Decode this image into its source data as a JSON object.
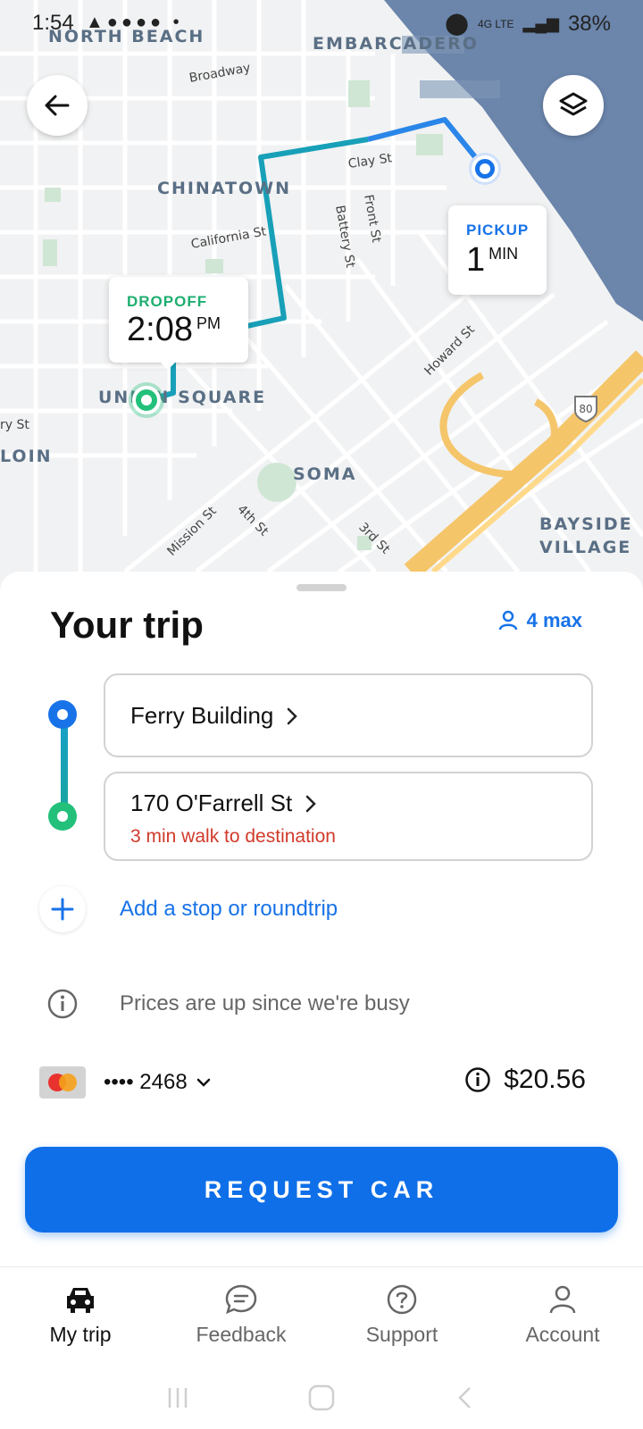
{
  "status_bar": {
    "time": "1:54",
    "battery": "38%",
    "network": "4G LTE"
  },
  "map": {
    "areas": [
      "NORTH BEACH",
      "EMBARCADERO",
      "CHINATOWN",
      "UNION SQUARE",
      "LOIN",
      "SOMA",
      "BAYSIDE",
      "VILLAGE"
    ],
    "streets": [
      "Broadway",
      "Clay St",
      "California St",
      "Front St",
      "Battery St",
      "Howard St",
      "Mission St",
      "4th St",
      "3rd St",
      "ry St"
    ],
    "highway": "80",
    "back_button": "back-arrow-icon",
    "layers_button": "layers-icon",
    "pickup": {
      "caption": "PICKUP",
      "value": "1",
      "unit": "MIN"
    },
    "dropoff": {
      "caption": "DROPOFF",
      "value": "2:08",
      "unit": "PM"
    }
  },
  "trip": {
    "title": "Your trip",
    "max_passengers": "4 max",
    "stops": [
      {
        "name": "Ferry Building"
      },
      {
        "name": "170 O'Farrell St",
        "note": "3 min walk to destination"
      }
    ],
    "add_stop": "Add a stop or roundtrip",
    "price_notice": "Prices are up since we're busy",
    "card_mask": "•••• 2468",
    "price": "$20.56",
    "request_button": "REQUEST CAR"
  },
  "nav": [
    {
      "label": "My trip",
      "icon": "car-icon"
    },
    {
      "label": "Feedback",
      "icon": "chat-icon"
    },
    {
      "label": "Support",
      "icon": "help-icon"
    },
    {
      "label": "Account",
      "icon": "person-icon"
    }
  ],
  "colors": {
    "accent": "#0f6fe9",
    "pickup": "#1873e8",
    "dropoff": "#22c07a",
    "route": "#18a0b8",
    "warning": "#d03a2a"
  }
}
